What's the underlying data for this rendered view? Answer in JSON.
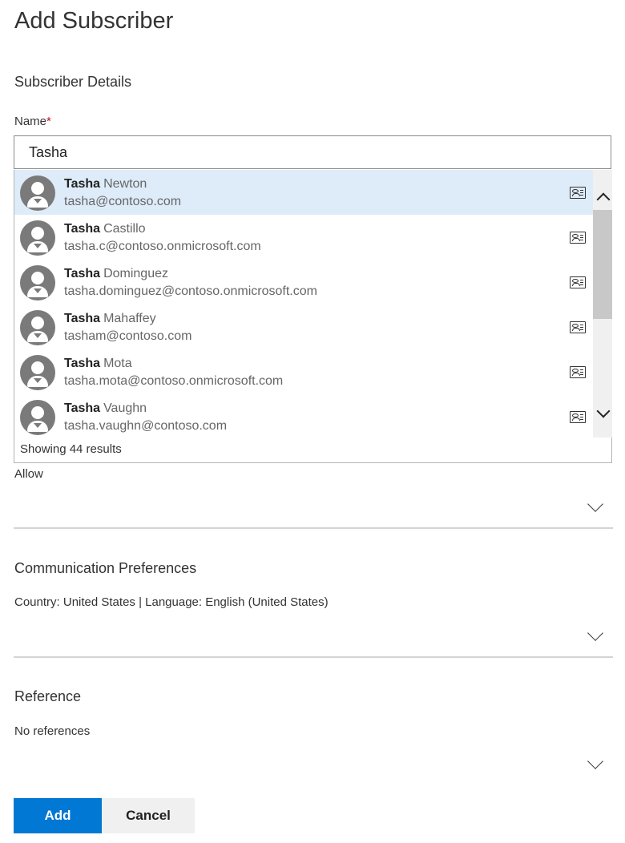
{
  "page": {
    "title": "Add Subscriber"
  },
  "subscriber_details": {
    "heading": "Subscriber Details",
    "name_label": "Name",
    "required_mark": "*",
    "name_value": "Tasha"
  },
  "suggestions": {
    "results": [
      {
        "first": "Tasha",
        "last": "Newton",
        "email": "tasha@contoso.com",
        "selected": true
      },
      {
        "first": "Tasha",
        "last": "Castillo",
        "email": "tasha.c@contoso.onmicrosoft.com"
      },
      {
        "first": "Tasha",
        "last": "Dominguez",
        "email": "tasha.dominguez@contoso.onmicrosoft.com"
      },
      {
        "first": "Tasha",
        "last": "Mahaffey",
        "email": "tasham@contoso.com"
      },
      {
        "first": "Tasha",
        "last": "Mota",
        "email": "tasha.mota@contoso.onmicrosoft.com"
      },
      {
        "first": "Tasha",
        "last": "Vaughn",
        "email": "tasha.vaughn@contoso.com"
      }
    ],
    "status": "Showing 44 results"
  },
  "allow": {
    "label": "Allow"
  },
  "communication": {
    "heading": "Communication Preferences",
    "summary": "Country: United States | Language: English (United States)"
  },
  "reference": {
    "heading": "Reference",
    "summary": "No references"
  },
  "actions": {
    "add_label": "Add",
    "cancel_label": "Cancel"
  },
  "colors": {
    "accent": "#0078d4",
    "selected_row": "#deecf9",
    "required": "#c50f1f"
  },
  "icons": [
    "contact-card-icon",
    "avatar-icon",
    "chevron-up-icon",
    "chevron-down-icon"
  ]
}
